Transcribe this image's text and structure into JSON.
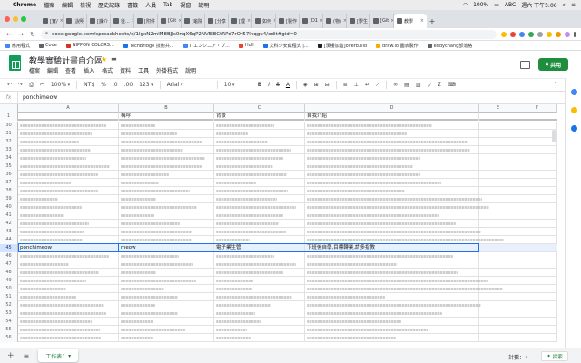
{
  "mac_menubar": {
    "app": "Chrome",
    "items": [
      "檔案",
      "編輯",
      "檢視",
      "歷史記錄",
      "書籤",
      "人員",
      "Tab",
      "視窗",
      "說明"
    ],
    "battery": "100%",
    "input_method": "ABC",
    "clock": "週六 下午5:06"
  },
  "tabs": [
    {
      "label": "[實/"
    },
    {
      "label": "[說明"
    },
    {
      "label": "[課介"
    },
    {
      "label": "從..."
    },
    {
      "label": "[附件"
    },
    {
      "label": "[Git"
    },
    {
      "label": "[龜院"
    },
    {
      "label": "[分享"
    },
    {
      "label": "[理"
    },
    {
      "label": "如何"
    },
    {
      "label": "[製作"
    },
    {
      "label": "[D1"
    },
    {
      "label": "(物)"
    },
    {
      "label": "[學生"
    },
    {
      "label": "[Git"
    },
    {
      "label": "教學",
      "active": true
    }
  ],
  "address": {
    "url": "docs.google.com/spreadsheets/d/1lgxN2mlM8BJJs0nqX6qP2NVElECtRPd7rOr57lnqgu4/edit#gid=0"
  },
  "bookmarks": [
    {
      "label": "應用程式",
      "color": "#4285f4"
    },
    {
      "label": "Code",
      "color": "#5f6368"
    },
    {
      "label": "NIPPON COLORS...",
      "color": "#d93025"
    },
    {
      "label": "TechBridge 技術共...",
      "color": "#1a73e8"
    },
    {
      "label": "ITエンジニア・プ...",
      "color": "#4285f4"
    },
    {
      "label": "Hull",
      "color": "#ea4335"
    },
    {
      "label": "文科少女藏程式 |...",
      "color": "#1a73e8"
    },
    {
      "label": "[漢樓加蓋]overbuild",
      "color": "#202124"
    },
    {
      "label": "draw.io 圖表製作",
      "color": "#f9ab00"
    },
    {
      "label": "eddychang部落格",
      "color": "#5f6368"
    }
  ],
  "doc": {
    "title": "教學實驗計畫自介區",
    "menu": [
      "檔案",
      "編輯",
      "查看",
      "插入",
      "格式",
      "資料",
      "工具",
      "外掛程式",
      "說明"
    ],
    "share_label": "共用"
  },
  "toolbar": {
    "zoom": "100%",
    "currency": "NT$",
    "percent": "%",
    "decimals_less": ".0",
    "decimals_more": ".00",
    "number_format": "123",
    "font": "Arial",
    "font_size": "10",
    "bold": "B",
    "italic": "I",
    "strike": "S",
    "text_color": "A"
  },
  "formula_bar": {
    "fx_label": "fx",
    "value": "ponchimeow"
  },
  "grid": {
    "columns": [
      "A",
      "B",
      "C",
      "D",
      "E",
      "F"
    ],
    "header_row": {
      "num": "1",
      "b": "稱呼",
      "c": "背景",
      "d": "自我介紹"
    },
    "row_numbers": [
      "30",
      "31",
      "32",
      "33",
      "34",
      "35",
      "36",
      "37",
      "38",
      "39",
      "40",
      "41",
      "42",
      "43",
      "44",
      "45",
      "46",
      "47",
      "48",
      "49",
      "50",
      "51",
      "52",
      "53",
      "54",
      "55",
      "56"
    ],
    "highlighted_row": {
      "num": "45",
      "a": "ponchimeow",
      "b": "meow",
      "c": "電子業生管",
      "d": "下班後自學,目標轉業,請多指教"
    }
  },
  "sheetbar": {
    "add_sheet_icon": "+",
    "all_sheets_icon": "≡",
    "sheet_name": "工作表1",
    "count_label": "計數：4",
    "explore_label": "探索"
  },
  "colors": {
    "sheets_green": "#0f9d58",
    "share_green": "#1e8e3e",
    "selection_blue": "#1a73e8",
    "highlight_row": "#e8f0fe"
  }
}
